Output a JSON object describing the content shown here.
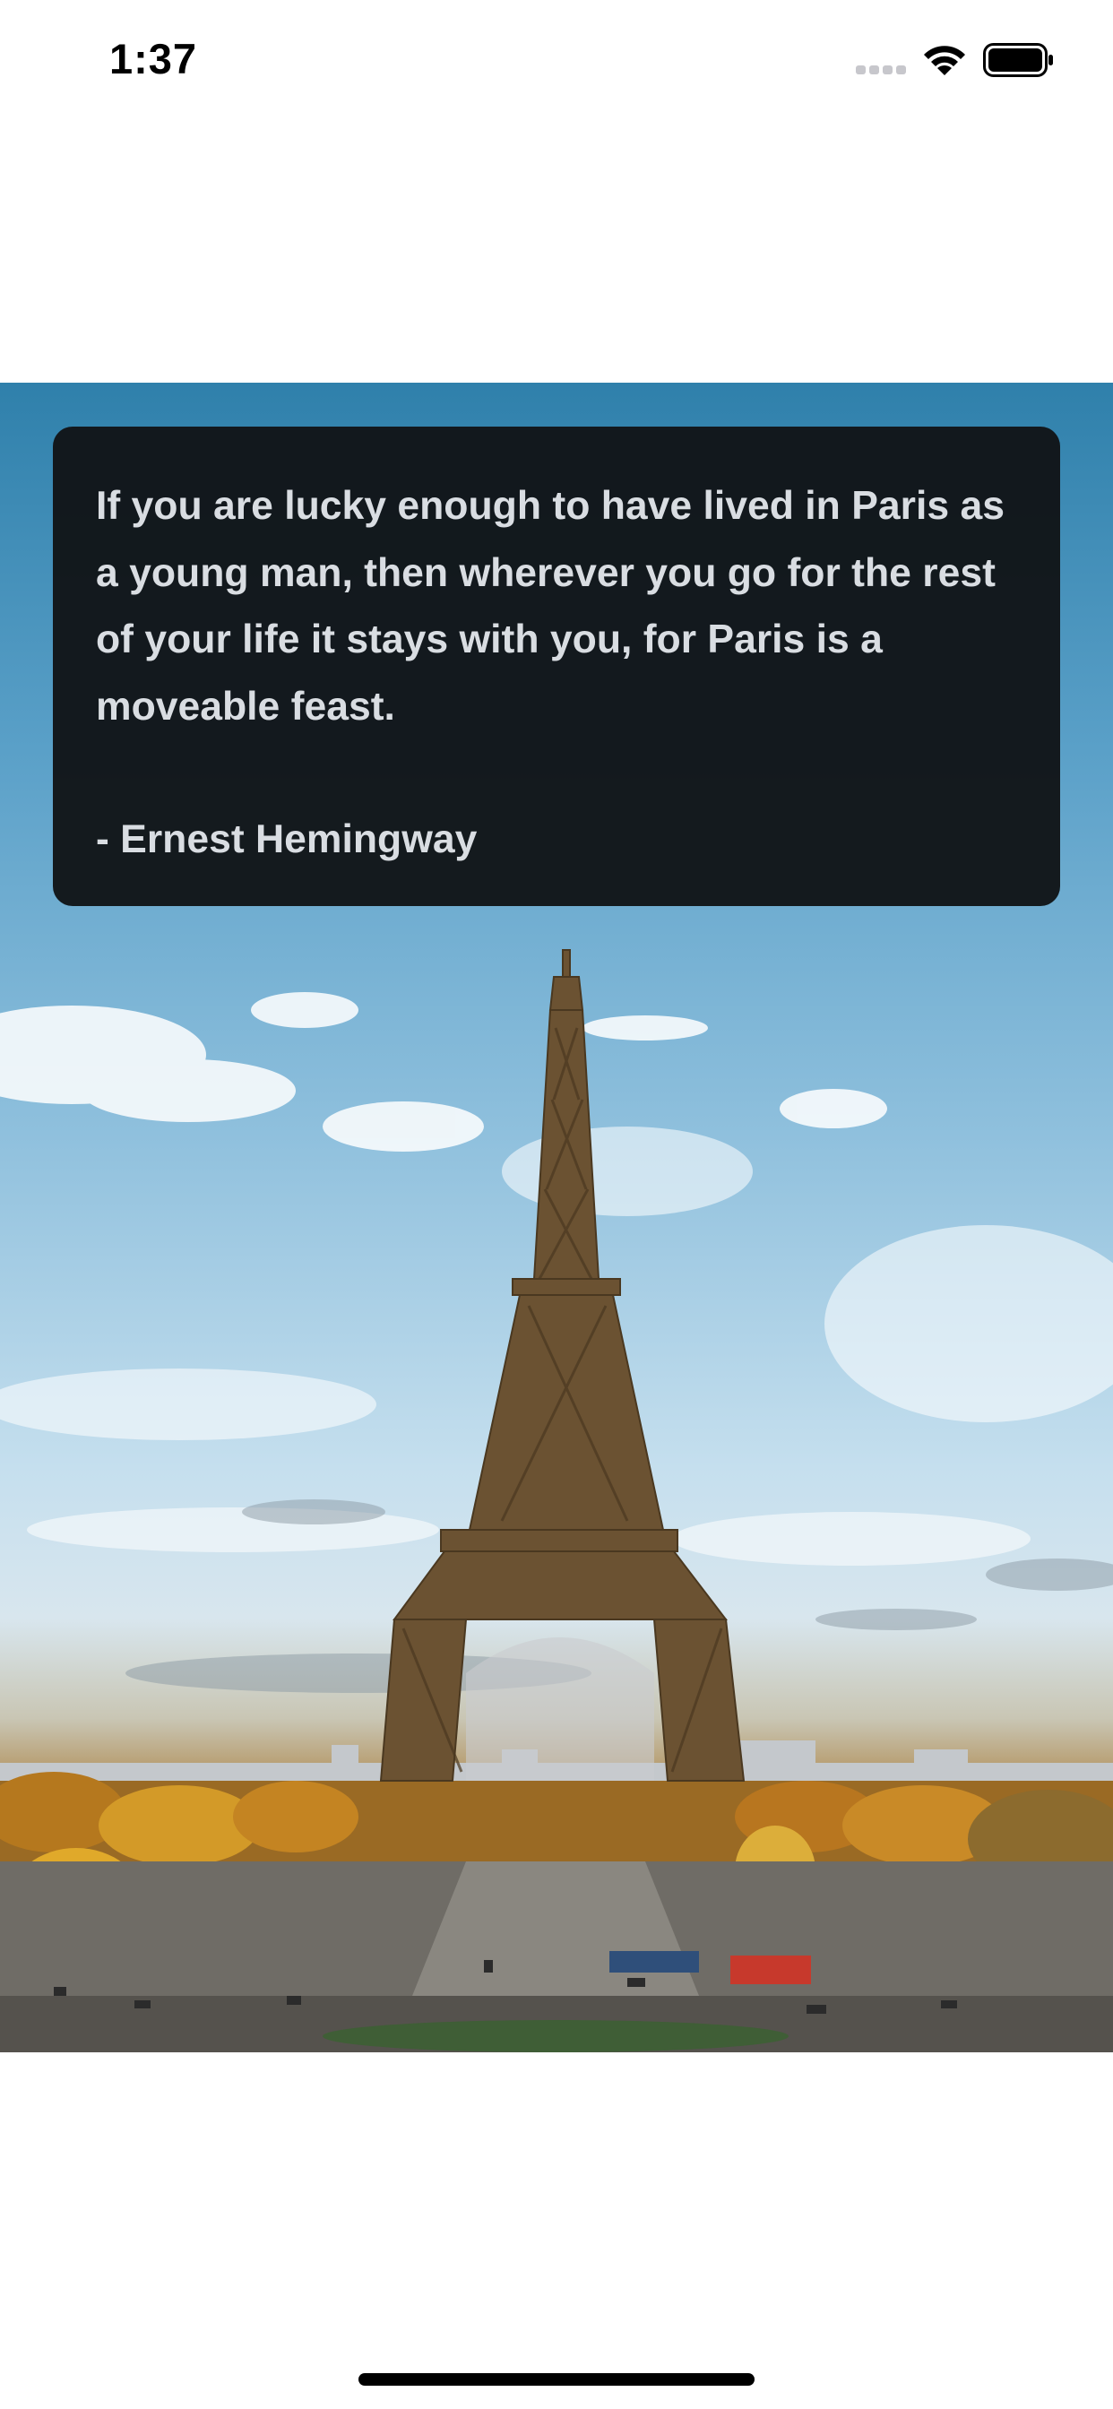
{
  "status_bar": {
    "time": "1:37",
    "icons": [
      "cellular-signal-icon",
      "wifi-icon",
      "battery-icon"
    ]
  },
  "quote": {
    "text": "If you are lucky enough to have lived in Paris as a young man, then wherever you go for the rest of your life it stays with you, for Paris is a moveable feast.",
    "author": "- Ernest Hemingway"
  },
  "colors": {
    "card_background": "#111417",
    "quote_text": "#d9dde2",
    "sky": "#5aa0c8",
    "tower": "#6b5232"
  }
}
